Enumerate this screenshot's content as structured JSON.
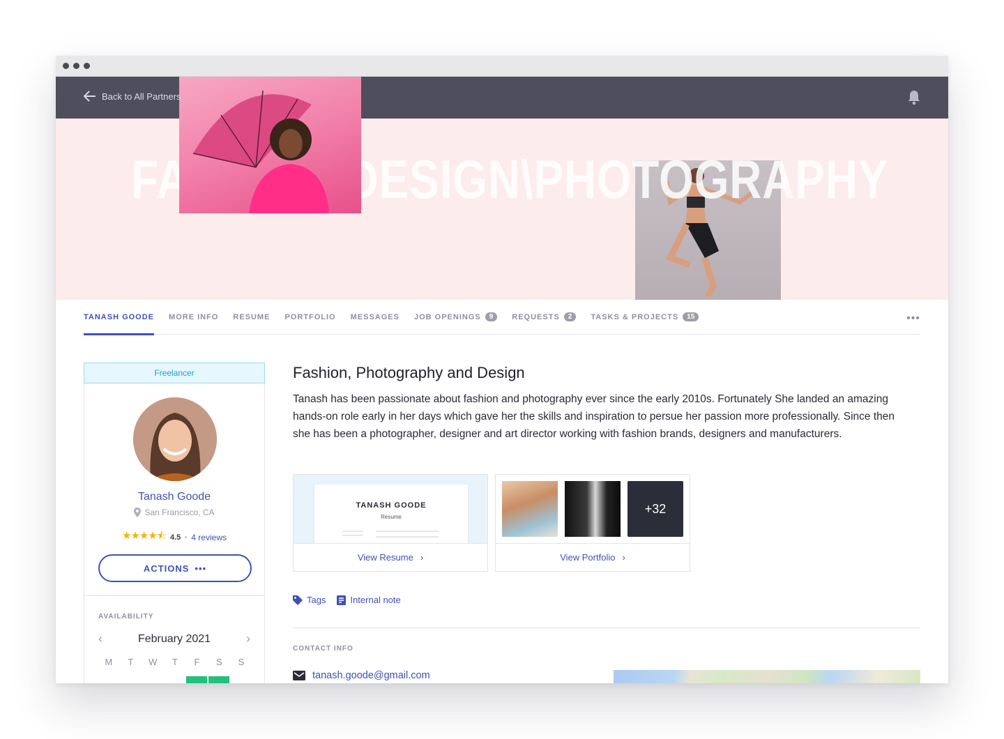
{
  "topbar": {
    "back_label": "Back to All Partners"
  },
  "hero": {
    "headline": "FASHION\\DESIGN\\PHOTOGRAPHY"
  },
  "tabs": [
    {
      "label": "TANASH GOODE",
      "active": true
    },
    {
      "label": "MORE INFO"
    },
    {
      "label": "RESUME"
    },
    {
      "label": "PORTFOLIO"
    },
    {
      "label": "MESSAGES"
    },
    {
      "label": "JOB OPENINGS",
      "count": "9"
    },
    {
      "label": "REQUESTS",
      "count": "2"
    },
    {
      "label": "TASKS & PROJECTS",
      "count": "15"
    }
  ],
  "tabs_more": "•••",
  "profile": {
    "type_badge": "Freelancer",
    "name": "Tanash Goode",
    "location": "San Francisco, CA",
    "rating_stars": 4.5,
    "rating": "4.5",
    "reviews": "4 reviews",
    "actions_label": "ACTIONS",
    "actions_icon": "•••"
  },
  "availability": {
    "title": "AVAILABILITY",
    "month": "February 2021",
    "weekdays": [
      "M",
      "T",
      "W",
      "T",
      "F",
      "S",
      "S"
    ]
  },
  "main": {
    "heading": "Fashion, Photography and Design",
    "bio": "Tanash has been passionate about fashion and photography ever since the early 2010s. Fortunately She landed an amazing hands-on role early in her days which gave her the skills and inspiration to persue her passion more professionally. Since then she has been a photographer, designer and art director working with fashion brands, designers and manufacturers."
  },
  "resume_card": {
    "name": "TANASH GOODE",
    "subtitle": "Resume",
    "link": "View Resume"
  },
  "portfolio_card": {
    "more_count": "+32",
    "link": "View Portfolio"
  },
  "links": {
    "tags": "Tags",
    "note": "Internal note"
  },
  "contact": {
    "title": "CONTACT INFO",
    "email": "tanash.goode@gmail.com"
  },
  "colors": {
    "accent": "#3f51b5",
    "topbar": "#4f4e5d",
    "hero_bg": "#fdecec",
    "available": "#1fc17b",
    "star": "#f4b400"
  }
}
